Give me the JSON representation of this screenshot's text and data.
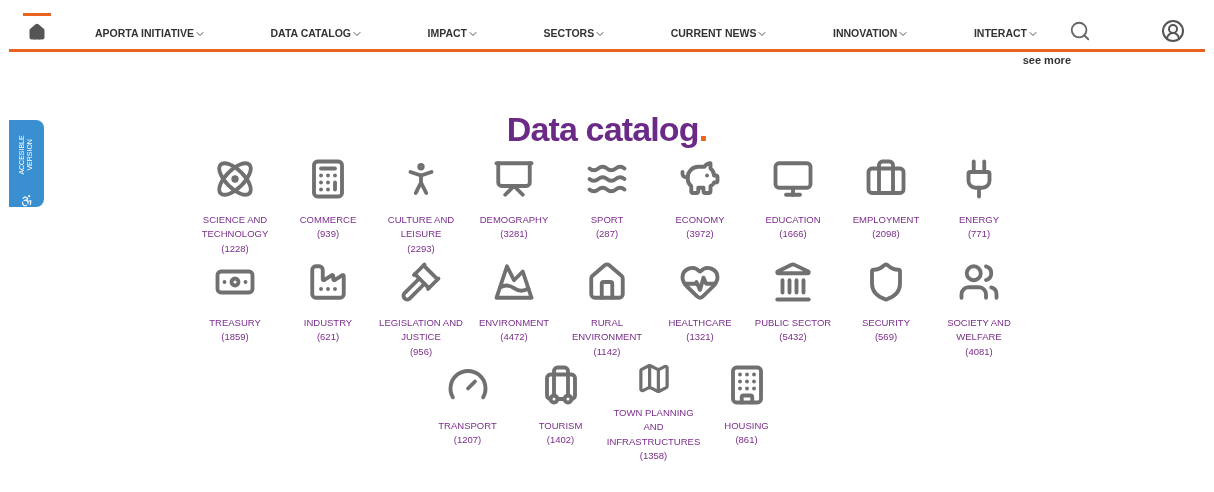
{
  "nav": {
    "home_selected": true,
    "items": [
      {
        "label": "APORTA INITIATIVE"
      },
      {
        "label": "DATA CATALOG"
      },
      {
        "label": "IMPACT"
      },
      {
        "label": "SECTORS"
      },
      {
        "label": "CURRENT NEWS"
      },
      {
        "label": "INNOVATION"
      },
      {
        "label": "INTERACT"
      }
    ],
    "see_more": "see more"
  },
  "accessible_tab": {
    "label": "ACCESIBLE VERSION"
  },
  "title": "Data catalog",
  "title_dot": ".",
  "categories": [
    {
      "name": "SCIENCE AND TECHNOLOGY",
      "count": "(1228)"
    },
    {
      "name": "COMMERCE",
      "count": "(939)"
    },
    {
      "name": "CULTURE AND LEISURE",
      "count": "(2293)"
    },
    {
      "name": "DEMOGRAPHY",
      "count": "(3281)"
    },
    {
      "name": "SPORT",
      "count": "(287)"
    },
    {
      "name": "ECONOMY",
      "count": "(3972)"
    },
    {
      "name": "EDUCATION",
      "count": "(1666)"
    },
    {
      "name": "EMPLOYMENT",
      "count": "(2098)"
    },
    {
      "name": "ENERGY",
      "count": "(771)"
    },
    {
      "name": "TREASURY",
      "count": "(1859)"
    },
    {
      "name": "INDUSTRY",
      "count": "(621)"
    },
    {
      "name": "LEGISLATION AND JUSTICE",
      "count": "(956)"
    },
    {
      "name": "ENVIRONMENT",
      "count": "(4472)"
    },
    {
      "name": "RURAL ENVIRONMENT",
      "count": "(1142)"
    },
    {
      "name": "HEALTHCARE",
      "count": "(1321)"
    },
    {
      "name": "PUBLIC SECTOR",
      "count": "(5432)"
    },
    {
      "name": "SECURITY",
      "count": "(569)"
    },
    {
      "name": "SOCIETY AND WELFARE",
      "count": "(4081)"
    },
    {
      "name": "TRANSPORT",
      "count": "(1207)"
    },
    {
      "name": "TOURISM",
      "count": "(1402)"
    },
    {
      "name": "TOWN PLANNING AND INFRASTRUCTURES",
      "count": "(1358)"
    },
    {
      "name": "HOUSING",
      "count": "(861)"
    }
  ]
}
